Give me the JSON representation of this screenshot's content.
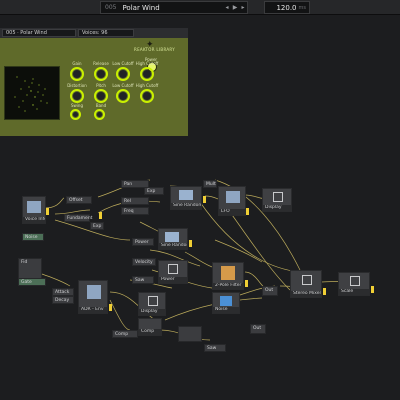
{
  "topbar": {
    "preset_number": "005",
    "preset_name": "Polar Wind",
    "prev_icon": "step-back-icon",
    "play_icon": "play-icon",
    "next_icon": "step-forward-icon",
    "tempo": "120.0",
    "tempo_unit": "ms"
  },
  "panel": {
    "preset_label": "005 · Polar Wind",
    "voices_label": "Voices: 96",
    "brand": "REAKTOR LIBRARY",
    "power_label": "Power",
    "knobs": [
      {
        "label": "Gain",
        "value": ""
      },
      {
        "label": "Release",
        "value": ""
      },
      {
        "label": "Low Cutoff",
        "value": ""
      },
      {
        "label": "High Cutoff",
        "value": ""
      },
      {
        "label": "Distortion",
        "value": ""
      },
      {
        "label": "Pitch",
        "value": ""
      },
      {
        "label": "Low Cutoff",
        "value": ""
      },
      {
        "label": "High Cutoff",
        "value": ""
      },
      {
        "label": "Swing",
        "value": ""
      },
      {
        "label": "Band",
        "value": ""
      }
    ]
  },
  "nodes": [
    {
      "title": "Voice Info"
    },
    {
      "title": "Offset"
    },
    {
      "title": "Fundament"
    },
    {
      "title": "Exp"
    },
    {
      "title": "Sine Random"
    },
    {
      "title": "LFO"
    },
    {
      "title": "Display"
    },
    {
      "title": "Noise"
    },
    {
      "title": "Sine Random"
    },
    {
      "title": "Power"
    },
    {
      "title": "2-Pole Filter"
    },
    {
      "title": "Noise"
    },
    {
      "title": "Stereo Mixer"
    },
    {
      "title": "Scale"
    },
    {
      "title": "ADR - Env"
    },
    {
      "title": "Display"
    },
    {
      "title": "Gate"
    },
    {
      "title": "Comp"
    },
    {
      "title": "Saw"
    },
    {
      "title": "Power"
    },
    {
      "title": "Fid"
    },
    {
      "title": "Velocity"
    },
    {
      "title": "Attack"
    },
    {
      "title": "Decay"
    },
    {
      "title": "Out"
    },
    {
      "title": "Pan"
    },
    {
      "title": "Rel"
    },
    {
      "title": "Freq"
    },
    {
      "title": "Exp"
    },
    {
      "title": "Mult"
    },
    {
      "title": "Out"
    }
  ]
}
